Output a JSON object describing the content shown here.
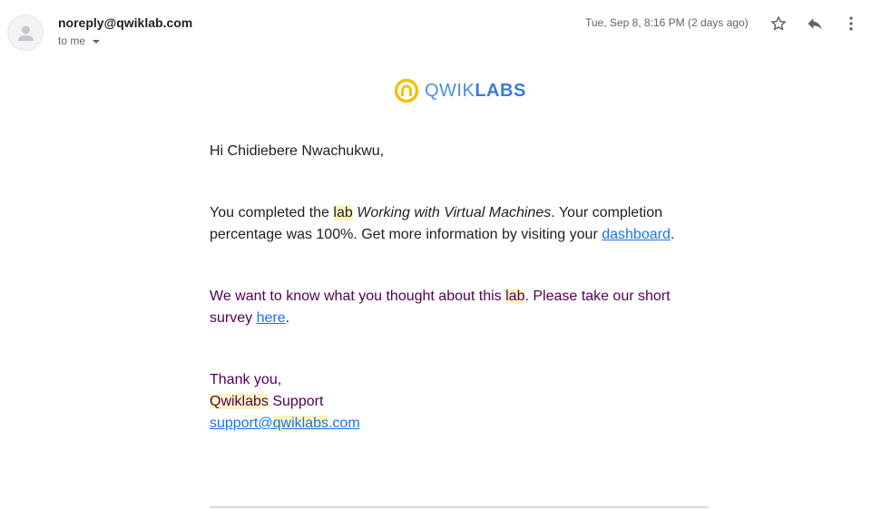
{
  "header": {
    "sender": "noreply@qwiklab.com",
    "to_label": "to me",
    "date": "Tue, Sep 8, 8:16 PM (2 days ago)"
  },
  "icons": {
    "avatar": "person-icon",
    "star": "star-icon",
    "reply": "reply-icon",
    "more": "more-vert-icon",
    "logo": "qwiklabs-logo-icon"
  },
  "logo": {
    "light": "QWIK",
    "bold": "LABS"
  },
  "body": {
    "greeting": "Hi Chidiebere Nwachukwu,",
    "completion": {
      "before": "You completed the ",
      "hl_word": "lab",
      "space": " ",
      "lab_title": "Working with Virtual Machines",
      "after": ". Your completion percentage was 100%. Get more information by visiting your ",
      "link": "dashboard",
      "end": "."
    },
    "survey": {
      "before": "We want to know what you thought about this ",
      "hl_word": "lab",
      "after": ". Please take our short survey ",
      "link": "here",
      "end": "."
    },
    "signoff": {
      "thanks": "Thank you,",
      "team_hl": "Qwiklabs",
      "team_rest": " Support",
      "email_pre": "support@",
      "email_hl": "qwiklabs",
      "email_post": ".com"
    }
  },
  "colors": {
    "highlight": "#fdf6c3",
    "link": "#1a73e8",
    "quoted_text": "#500050",
    "logo_yellow": "#f4c20d",
    "logo_blue": "#4a90e2"
  }
}
